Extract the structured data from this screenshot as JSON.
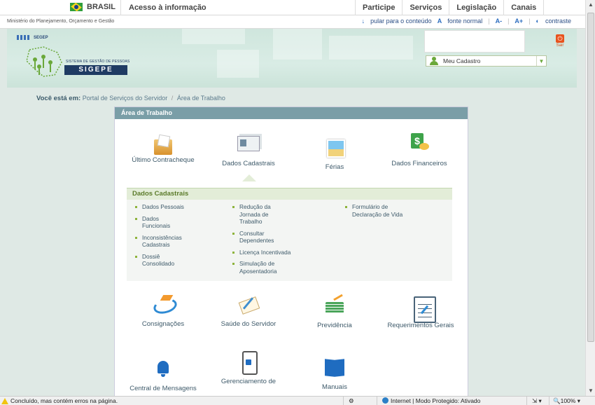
{
  "govbar": {
    "country": "BRASIL",
    "access_info": "Acesso à informação",
    "menu": [
      "Participe",
      "Serviços",
      "Legislação",
      "Canais"
    ]
  },
  "ministry": {
    "name": "Ministério do Planejamento, Orçamento e Gestão",
    "skip": "pular para o conteúdo",
    "font_normal": "fonte normal",
    "font_minus": "A-",
    "font_plus": "A+",
    "contrast": "contraste"
  },
  "header": {
    "segep": "SEGEP",
    "system_sub": "SISTEMA DE GESTÃO DE PESSOAS",
    "system": "SIGEPE",
    "profile_select": "Meu Cadastro",
    "logout": "Sair"
  },
  "breadcrumb": {
    "label": "Você está em:",
    "items": [
      "Portal de Serviços do Servidor",
      "Área de Trabalho"
    ]
  },
  "panel": {
    "title": "Área de Trabalho",
    "tiles_top": [
      {
        "label": "Último Contracheque",
        "icon": "folder-icon"
      },
      {
        "label": "Dados Cadastrais",
        "icon": "id-cards-icon"
      },
      {
        "label": "Férias",
        "icon": "photo-icon"
      },
      {
        "label": "Dados Financeiros",
        "icon": "money-icon"
      }
    ],
    "submenu": {
      "title": "Dados Cadastrais",
      "col1": [
        "Dados Pessoais",
        "Dados Funcionais",
        "Inconsistências Cadastrais",
        "Dossiê Consolidado"
      ],
      "col2": [
        "Redução da Jornada de Trabalho",
        "Consultar Dependentes",
        "Licença Incentivada",
        "Simulação de Aposentadoria"
      ],
      "col3": [
        "Formulário de Declaração de Vida"
      ]
    },
    "tiles_mid": [
      {
        "label": "Consignações",
        "icon": "plane-icon"
      },
      {
        "label": "Saúde do Servidor",
        "icon": "health-icon"
      },
      {
        "label": "Previdência",
        "icon": "money-stack-icon"
      },
      {
        "label": "Requerimentos Gerais",
        "icon": "document-icon"
      }
    ],
    "tiles_bottom": [
      {
        "label": "Central de Mensagens",
        "icon": "bell-icon"
      },
      {
        "label": "Gerenciamento de",
        "icon": "phone-lock-icon"
      },
      {
        "label": "Manuais",
        "icon": "book-icon"
      }
    ]
  },
  "statusbar": {
    "message": "Concluído, mas contém erros na página.",
    "zone": "Internet | Modo Protegido: Ativado",
    "zoom": "100%"
  }
}
